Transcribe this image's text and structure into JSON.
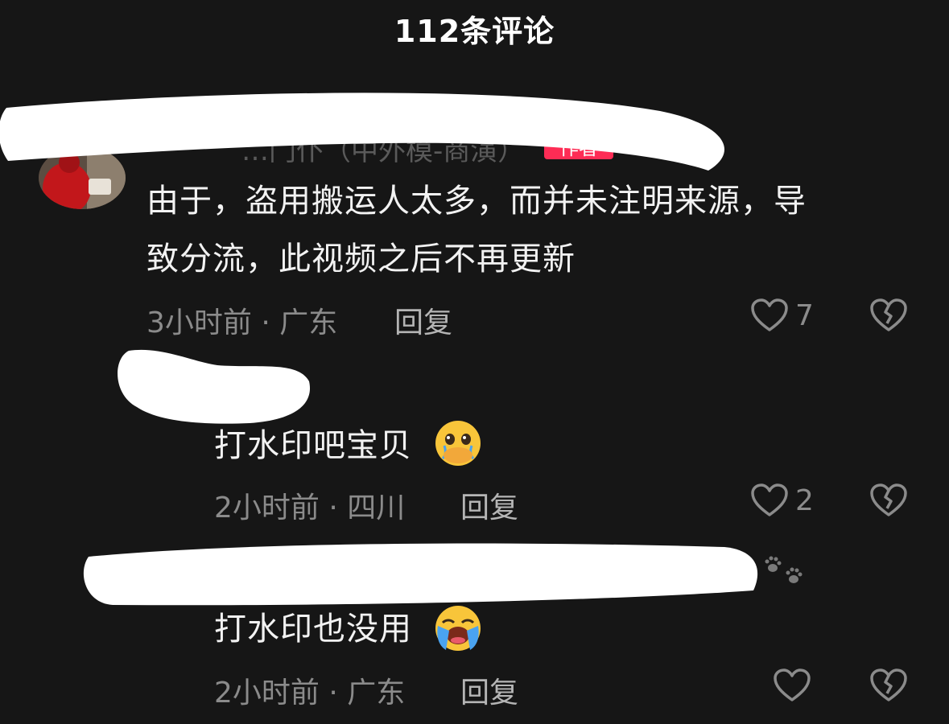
{
  "header": {
    "title": "112条评论"
  },
  "comments": [
    {
      "username": "…门仆（中外模-商演）",
      "badge": "作者",
      "text_line1": "由于，盗用搬运人太多，而并未注明来源，导",
      "text_line2": "致分流，此视频之后不再更新",
      "meta": "3小时前 · 广东",
      "reply": "回复",
      "likes": "7"
    },
    {
      "text": "打水印吧宝贝",
      "emoji": "hand-over-mouth-crying-emoji",
      "meta": "2小时前 · 四川",
      "reply": "回复",
      "likes": "2"
    },
    {
      "text": "打水印也没用",
      "emoji": "loudly-crying-emoji",
      "meta": "2小时前 · 广东",
      "reply": "回复",
      "likes": ""
    }
  ],
  "colors": {
    "background": "#161616",
    "author_badge": "#fe2c55",
    "meta": "#8b8b8b",
    "text": "#f2f2f2"
  }
}
